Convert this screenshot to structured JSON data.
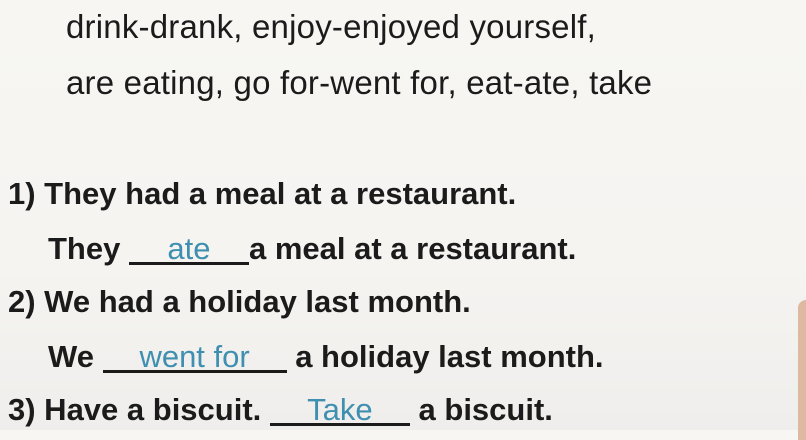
{
  "word_bank": {
    "line1": "drink-drank, enjoy-enjoyed yourself,",
    "line2": "are eating, go for-went for, eat-ate, take"
  },
  "exercises": [
    {
      "prompt": "1) They had a meal at a restaurant.",
      "pre": "They",
      "answer": "ate",
      "post": "a meal at a restaurant."
    },
    {
      "prompt": "2) We had a holiday last month.",
      "pre": "We",
      "answer": "went for",
      "post": "a holiday last month."
    },
    {
      "prompt": "3) Have a biscuit.",
      "answer": "Take",
      "post": "a biscuit."
    }
  ]
}
